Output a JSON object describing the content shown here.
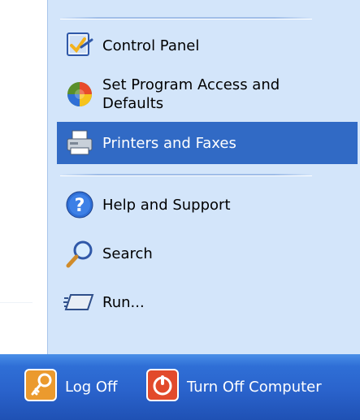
{
  "menu": {
    "items": [
      {
        "label": "Control Panel",
        "icon": "control-panel-icon"
      },
      {
        "label": "Set Program Access and Defaults",
        "icon": "program-access-icon"
      },
      {
        "label": "Printers and Faxes",
        "icon": "printer-icon",
        "selected": true
      },
      {
        "label": "Help and Support",
        "icon": "help-icon"
      },
      {
        "label": "Search",
        "icon": "search-icon"
      },
      {
        "label": "Run...",
        "icon": "run-icon"
      }
    ]
  },
  "footer": {
    "log_off_label": "Log Off",
    "turn_off_label": "Turn Off Computer"
  },
  "colors": {
    "panel_bg": "#d3e5fa",
    "selected_bg": "#316ac5",
    "bar_bg": "#2a63cc"
  }
}
